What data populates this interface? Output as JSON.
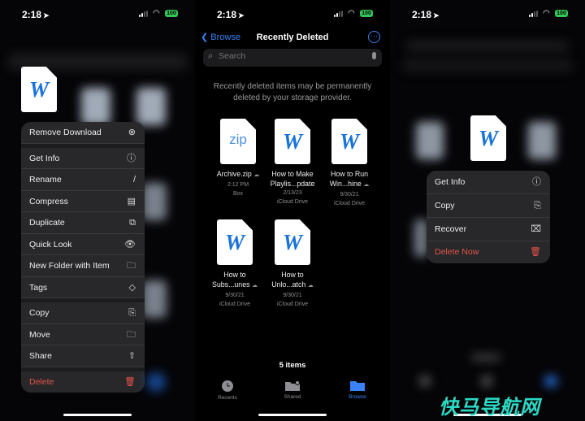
{
  "status_bar": {
    "time": "2:18",
    "battery": "100"
  },
  "panel1": {
    "menu": [
      {
        "label": "Remove Download",
        "icon": "⊗"
      },
      {
        "label": "Get Info",
        "icon": "ⓘ"
      },
      {
        "label": "Rename",
        "icon": "/"
      },
      {
        "label": "Compress",
        "icon": "▤"
      },
      {
        "label": "Duplicate",
        "icon": "⧉"
      },
      {
        "label": "Quick Look",
        "icon": "👁"
      },
      {
        "label": "New Folder with Item",
        "icon": "🗀"
      },
      {
        "label": "Tags",
        "icon": "◇"
      },
      {
        "label": "Copy",
        "icon": "⎘"
      },
      {
        "label": "Move",
        "icon": "🗀"
      },
      {
        "label": "Share",
        "icon": "⇧"
      },
      {
        "label": "Delete",
        "icon": "🗑"
      }
    ]
  },
  "panel2": {
    "back_label": "Browse",
    "title": "Recently Deleted",
    "more_icon": "···",
    "search_placeholder": "Search",
    "notice": "Recently deleted items may be permanently deleted by your storage provider.",
    "files": [
      {
        "type": "zip",
        "glyph": "zip",
        "name1": "Archive.zip",
        "name2": "",
        "date": "2:12 PM",
        "location": "Box"
      },
      {
        "type": "word",
        "glyph": "W",
        "name1": "How to Make",
        "name2": "Playlis...pdate",
        "date": "2/13/23",
        "location": "iCloud Drive"
      },
      {
        "type": "word",
        "glyph": "W",
        "name1": "How to Run",
        "name2": "Win...hine",
        "date": "9/30/21",
        "location": "iCloud Drive"
      },
      {
        "type": "word",
        "glyph": "W",
        "name1": "How to",
        "name2": "Subs...unes",
        "date": "9/30/21",
        "location": "iCloud Drive"
      },
      {
        "type": "word",
        "glyph": "W",
        "name1": "How to",
        "name2": "Unlo...atch",
        "date": "9/30/21",
        "location": "iCloud Drive"
      }
    ],
    "item_count": "5 items",
    "tabs": [
      {
        "label": "Recents",
        "active": false
      },
      {
        "label": "Shared",
        "active": false
      },
      {
        "label": "Browse",
        "active": true
      }
    ]
  },
  "panel3": {
    "menu": [
      {
        "label": "Get Info",
        "icon": "ⓘ"
      },
      {
        "label": "Copy",
        "icon": "⎘"
      },
      {
        "label": "Recover",
        "icon": "⌧"
      },
      {
        "label": "Delete Now",
        "icon": "🗑"
      }
    ]
  },
  "word_glyph": "W",
  "cloud_glyph": "☁",
  "watermark": "快马导航网",
  "colors": {
    "accent": "#3a82f7",
    "danger": "#e5534b",
    "battery": "#34c759",
    "word": "#1a73d9"
  }
}
